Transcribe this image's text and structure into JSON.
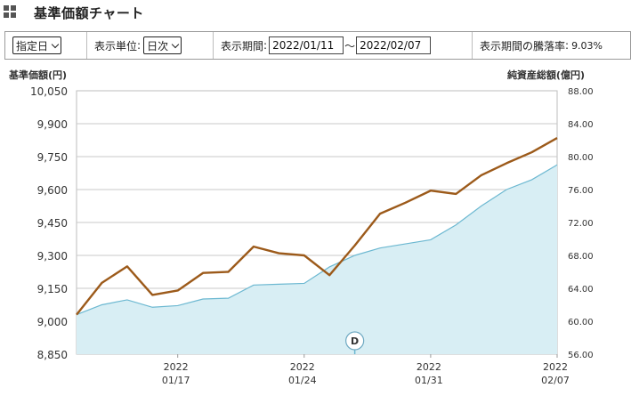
{
  "header": {
    "title": "基準価額チャート",
    "icon": "grid-icon"
  },
  "toolbar": {
    "mode_select": "指定日",
    "unit_label": "表示単位",
    "unit_select": "日次",
    "period_label": "表示期間",
    "start_date": "2022/01/11",
    "tilde": "〜",
    "end_date": "2022/02/07",
    "change_label": "表示期間の騰落率",
    "change_value": "9.03%"
  },
  "colors": {
    "price_line": "#9c5a1a",
    "asset_line": "#6cb8d1",
    "asset_fill": "#d8eef4",
    "grid": "#c8c8c8"
  },
  "chart_data": {
    "type": "line",
    "left_axis_title": "基準価額(円)",
    "right_axis_title": "純資産総額(億円)",
    "left_ylim": [
      8850,
      10050
    ],
    "right_ylim": [
      56,
      88
    ],
    "left_ticks": [
      "10,050",
      "9,900",
      "9,750",
      "9,600",
      "9,450",
      "9,300",
      "9,150",
      "9,000",
      "8,850"
    ],
    "right_ticks": [
      "88.00",
      "84.00",
      "80.00",
      "76.00",
      "72.00",
      "68.00",
      "64.00",
      "60.00",
      "56.00"
    ],
    "x_ticks": [
      {
        "year": "2022",
        "date": "01/17"
      },
      {
        "year": "2022",
        "date": "01/24"
      },
      {
        "year": "2022",
        "date": "01/31"
      },
      {
        "year": "2022",
        "date": "02/07"
      }
    ],
    "dates": [
      "2022/01/11",
      "2022/01/12",
      "2022/01/13",
      "2022/01/14",
      "2022/01/17",
      "2022/01/18",
      "2022/01/19",
      "2022/01/20",
      "2022/01/21",
      "2022/01/24",
      "2022/01/25",
      "2022/01/26",
      "2022/01/27",
      "2022/01/28",
      "2022/01/31",
      "2022/02/01",
      "2022/02/02",
      "2022/02/03",
      "2022/02/04",
      "2022/02/07"
    ],
    "series": [
      {
        "name": "基準価額",
        "axis": "left",
        "values": [
          9030,
          9175,
          9250,
          9120,
          9140,
          9220,
          9225,
          9340,
          9310,
          9300,
          9210,
          9345,
          9490,
          9540,
          9595,
          9580,
          9665,
          9720,
          9770,
          9835
        ]
      },
      {
        "name": "純資産総額",
        "axis": "right",
        "values": [
          60.8,
          62.0,
          62.6,
          61.7,
          61.9,
          62.7,
          62.8,
          64.4,
          64.5,
          64.6,
          66.6,
          68.0,
          68.9,
          69.4,
          69.9,
          71.7,
          74.0,
          76.0,
          77.2,
          79.0
        ]
      }
    ],
    "annotations": [
      {
        "label": "D",
        "date": "2022/01/26"
      }
    ]
  }
}
